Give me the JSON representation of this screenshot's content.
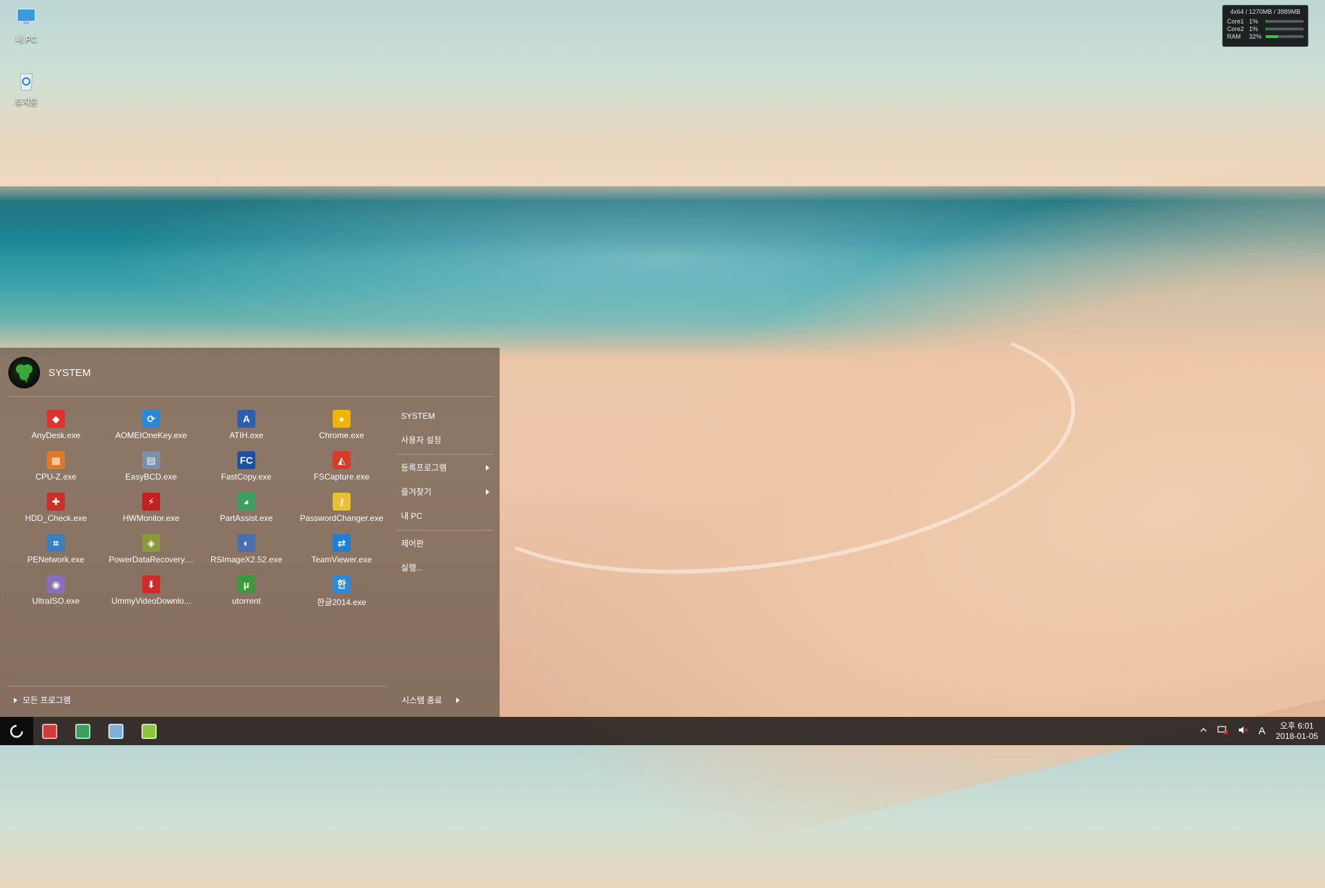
{
  "desktop": {
    "icons": [
      {
        "label": "내 PC",
        "icon": "computer-icon"
      },
      {
        "label": "휴지통",
        "icon": "recycle-bin-icon"
      }
    ]
  },
  "sysmon": {
    "header": "4x64 / 1270MB / 3989MB",
    "rows": [
      {
        "label": "Core1",
        "value": "1%",
        "fraction": 0.01
      },
      {
        "label": "Core2",
        "value": "1%",
        "fraction": 0.01
      },
      {
        "label": "RAM",
        "value": "32%",
        "fraction": 0.32
      }
    ],
    "bar_color": "#38c44a"
  },
  "start_menu": {
    "user_name": "SYSTEM",
    "apps": [
      {
        "label": "AnyDesk.exe",
        "icon": "anydesk-icon",
        "color": "#e0322d",
        "glyph": "◆"
      },
      {
        "label": "AOMEIOneKey.exe",
        "icon": "aomei-onekey-icon",
        "color": "#2b88d8",
        "glyph": "⟳"
      },
      {
        "label": "ATIH.exe",
        "icon": "acronis-icon",
        "color": "#2a5fb5",
        "glyph": "A"
      },
      {
        "label": "Chrome.exe",
        "icon": "chrome-icon",
        "color": "#f2b400",
        "glyph": "●"
      },
      {
        "label": "CPU-Z.exe",
        "icon": "cpu-z-icon",
        "color": "#e07a2a",
        "glyph": "▦"
      },
      {
        "label": "EasyBCD.exe",
        "icon": "easybcd-icon",
        "color": "#7d8fa6",
        "glyph": "▤"
      },
      {
        "label": "FastCopy.exe",
        "icon": "fastcopy-icon",
        "color": "#1d4fa3",
        "glyph": "FC"
      },
      {
        "label": "FSCapture.exe",
        "icon": "fscapture-icon",
        "color": "#d93b2b",
        "glyph": "◭"
      },
      {
        "label": "HDD_Check.exe",
        "icon": "hdd-check-icon",
        "color": "#c8312a",
        "glyph": "✚"
      },
      {
        "label": "HWMonitor.exe",
        "icon": "hwmonitor-icon",
        "color": "#c41f1f",
        "glyph": "⚡"
      },
      {
        "label": "PartAssist.exe",
        "icon": "partassist-icon",
        "color": "#3aa060",
        "glyph": "◕"
      },
      {
        "label": "PasswordChanger.exe",
        "icon": "key-icon",
        "color": "#e8c030",
        "glyph": "⚷"
      },
      {
        "label": "PENetwork.exe",
        "icon": "network-icon",
        "color": "#3c7fc1",
        "glyph": "⌗"
      },
      {
        "label": "PowerDataRecovery....",
        "icon": "data-recovery-icon",
        "color": "#8a9a3a",
        "glyph": "◈"
      },
      {
        "label": "RSImageX2.52.exe",
        "icon": "rsimagex-icon",
        "color": "#4a6fb0",
        "glyph": "◐"
      },
      {
        "label": "TeamViewer.exe",
        "icon": "teamviewer-icon",
        "color": "#1f7ed6",
        "glyph": "⇄"
      },
      {
        "label": "UltraISO.exe",
        "icon": "ultraiso-icon",
        "color": "#8a6fb8",
        "glyph": "◉"
      },
      {
        "label": "UmmyVideoDownlo...",
        "icon": "ummy-downloader-icon",
        "color": "#d22a2a",
        "glyph": "⬇"
      },
      {
        "label": "utorrent",
        "icon": "utorrent-icon",
        "color": "#3c9a3c",
        "glyph": "μ"
      },
      {
        "label": "한글2014.exe",
        "icon": "hangul-icon",
        "color": "#2a8ad6",
        "glyph": "한"
      }
    ],
    "right_items": [
      {
        "label": "SYSTEM",
        "has_arrow": false
      },
      {
        "label": "사용자 설정",
        "has_arrow": false
      },
      {
        "label": "등록프로그램",
        "has_arrow": true
      },
      {
        "label": "즐겨찾기",
        "has_arrow": true
      },
      {
        "label": "내 PC",
        "has_arrow": false
      },
      {
        "label": "제어판",
        "has_arrow": false
      },
      {
        "label": "실행...",
        "has_arrow": false
      }
    ],
    "all_programs": "모든 프로그램",
    "shutdown": "시스템 종료"
  },
  "taskbar": {
    "apps": [
      {
        "icon": "pin-app-red-icon",
        "color": "#d43a3a"
      },
      {
        "icon": "partassist-taskbar-icon",
        "color": "#3aa060"
      },
      {
        "icon": "notepad-taskbar-icon",
        "color": "#7fb2d8"
      },
      {
        "icon": "monitor-taskbar-icon",
        "color": "#8cc43a"
      }
    ],
    "tray": {
      "ime": "A",
      "time": "오후 6:01",
      "date": "2018-01-05"
    }
  }
}
